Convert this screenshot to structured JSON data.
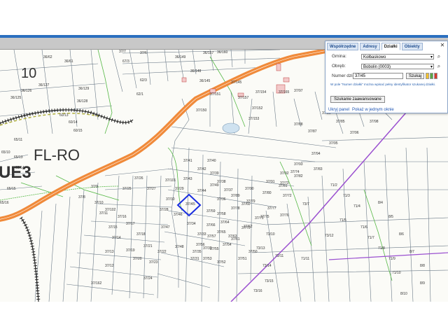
{
  "map": {
    "zones": [
      {
        "text": "10"
      },
      {
        "text": "FL-RO"
      },
      {
        "text": "UE3"
      }
    ],
    "parcels": [
      {
        "id": "36/62"
      },
      {
        "id": "36/61"
      },
      {
        "id": "36/127"
      },
      {
        "id": "36/126"
      },
      {
        "id": "36/125"
      },
      {
        "id": "36/129"
      },
      {
        "id": "36/128"
      },
      {
        "id": "37/7"
      },
      {
        "id": "37/6"
      },
      {
        "id": "67/3"
      },
      {
        "id": "62/3"
      },
      {
        "id": "62/1"
      },
      {
        "id": "60/13"
      },
      {
        "id": "60/14"
      },
      {
        "id": "60/15"
      },
      {
        "id": "65/11"
      },
      {
        "id": "65/10"
      },
      {
        "id": "65/13"
      },
      {
        "id": "65/14"
      },
      {
        "id": "65/15"
      },
      {
        "id": "65/16"
      },
      {
        "id": "36/157"
      },
      {
        "id": "36/160"
      },
      {
        "id": "36/149"
      },
      {
        "id": "36/148"
      },
      {
        "id": "36/145"
      },
      {
        "id": "37/145"
      },
      {
        "id": "37/151"
      },
      {
        "id": "37/152"
      },
      {
        "id": "37/153"
      },
      {
        "id": "37/154"
      },
      {
        "id": "37/150"
      },
      {
        "id": "37/157"
      },
      {
        "id": "37/162"
      },
      {
        "id": "37/165"
      },
      {
        "id": "37/97"
      },
      {
        "id": "37/98"
      },
      {
        "id": "37/96"
      },
      {
        "id": "37/95"
      },
      {
        "id": "37/94"
      },
      {
        "id": "37/93"
      },
      {
        "id": "37/92"
      },
      {
        "id": "37/91"
      },
      {
        "id": "37/90"
      },
      {
        "id": "37/89"
      },
      {
        "id": "37/88"
      },
      {
        "id": "37/87"
      },
      {
        "id": "37/86"
      },
      {
        "id": "37/85"
      },
      {
        "id": "37/84"
      },
      {
        "id": "37/83"
      },
      {
        "id": "37/82"
      },
      {
        "id": "37/81"
      },
      {
        "id": "37/80"
      },
      {
        "id": "37/79"
      },
      {
        "id": "37/78"
      },
      {
        "id": "37/77"
      },
      {
        "id": "37/76"
      },
      {
        "id": "37/75"
      },
      {
        "id": "37/74"
      },
      {
        "id": "37/73"
      },
      {
        "id": "37/72"
      },
      {
        "id": "37/71"
      },
      {
        "id": "37/70"
      },
      {
        "id": "37/66"
      },
      {
        "id": "37/65"
      },
      {
        "id": "37/64"
      },
      {
        "id": "37/63"
      },
      {
        "id": "37/62"
      },
      {
        "id": "37/61"
      },
      {
        "id": "37/60"
      },
      {
        "id": "37/59"
      },
      {
        "id": "37/58"
      },
      {
        "id": "37/57"
      },
      {
        "id": "37/56"
      },
      {
        "id": "37/55"
      },
      {
        "id": "37/54"
      },
      {
        "id": "37/53"
      },
      {
        "id": "37/52"
      },
      {
        "id": "37/51"
      },
      {
        "id": "37/50"
      },
      {
        "id": "37/49"
      },
      {
        "id": "37/48"
      },
      {
        "id": "37/47"
      },
      {
        "id": "37/46"
      },
      {
        "id": "37/45"
      },
      {
        "id": "37/44"
      },
      {
        "id": "37/43"
      },
      {
        "id": "37/42"
      },
      {
        "id": "37/41"
      },
      {
        "id": "37/40"
      },
      {
        "id": "37/39"
      },
      {
        "id": "37/38"
      },
      {
        "id": "37/37"
      },
      {
        "id": "37/36"
      },
      {
        "id": "37/35"
      },
      {
        "id": "37/34"
      },
      {
        "id": "37/33"
      },
      {
        "id": "37/32"
      },
      {
        "id": "37/31"
      },
      {
        "id": "37/30"
      },
      {
        "id": "37/29"
      },
      {
        "id": "37/28"
      },
      {
        "id": "37/27"
      },
      {
        "id": "37/26"
      },
      {
        "id": "37/25"
      },
      {
        "id": "37/24"
      },
      {
        "id": "37/23"
      },
      {
        "id": "37/22"
      },
      {
        "id": "37/21"
      },
      {
        "id": "37/20"
      },
      {
        "id": "37/19"
      },
      {
        "id": "37/18"
      },
      {
        "id": "37/17"
      },
      {
        "id": "37/16"
      },
      {
        "id": "37/15"
      },
      {
        "id": "37/14"
      },
      {
        "id": "37/13"
      },
      {
        "id": "37/12"
      },
      {
        "id": "37/11"
      },
      {
        "id": "37/10"
      },
      {
        "id": "37/9"
      },
      {
        "id": "37/8"
      },
      {
        "id": "37/102"
      },
      {
        "id": "37/101"
      },
      {
        "id": "71/2"
      },
      {
        "id": "71/3"
      },
      {
        "id": "71/4"
      },
      {
        "id": "71/5"
      },
      {
        "id": "71/6"
      },
      {
        "id": "71/7"
      },
      {
        "id": "71/8"
      },
      {
        "id": "71/9"
      },
      {
        "id": "71/10"
      },
      {
        "id": "71/11"
      },
      {
        "id": "73/7"
      },
      {
        "id": "73/10"
      },
      {
        "id": "73/11"
      },
      {
        "id": "73/12"
      },
      {
        "id": "73/13"
      },
      {
        "id": "73/14"
      },
      {
        "id": "73/15"
      },
      {
        "id": "73/16"
      },
      {
        "id": "8/4"
      },
      {
        "id": "8/5"
      },
      {
        "id": "8/6"
      },
      {
        "id": "8/7"
      },
      {
        "id": "8/8"
      },
      {
        "id": "8/9"
      },
      {
        "id": "8/10"
      }
    ],
    "highlighted_parcel": "37/45",
    "colors": {
      "road": "#f08a3a",
      "highlight": "#1a2ee0",
      "boundary": "#9a4fd0",
      "parcel_line": "#5a6a7a",
      "green_line": "#55b845",
      "zone_boundary": "#222222"
    }
  },
  "panel": {
    "tabs": [
      "Współrzędne",
      "Adresy",
      "Działki",
      "Obiekty"
    ],
    "active_tab": "Działki",
    "gmina_label": "Gmina:",
    "gmina_value": "Kołbaskowo",
    "obreb_label": "Obręb:",
    "obreb_value": "Bobolin (0003)",
    "numer_label": "Numer działki:",
    "numer_value": "37/45",
    "search_button": "Szukaj",
    "hint": "W pole \"Numer działki\" można wpisać pełny identyfikator szukanej działki.",
    "advanced_button": "Szukanie zaawansowane",
    "hide_link": "Ukryj panel",
    "show_link": "Pokaż w jednym oknie",
    "close_icon": "close-icon",
    "search_icon": "search-icon",
    "status_colors": [
      "#f2c12e",
      "#57a844",
      "#d9372c"
    ]
  }
}
